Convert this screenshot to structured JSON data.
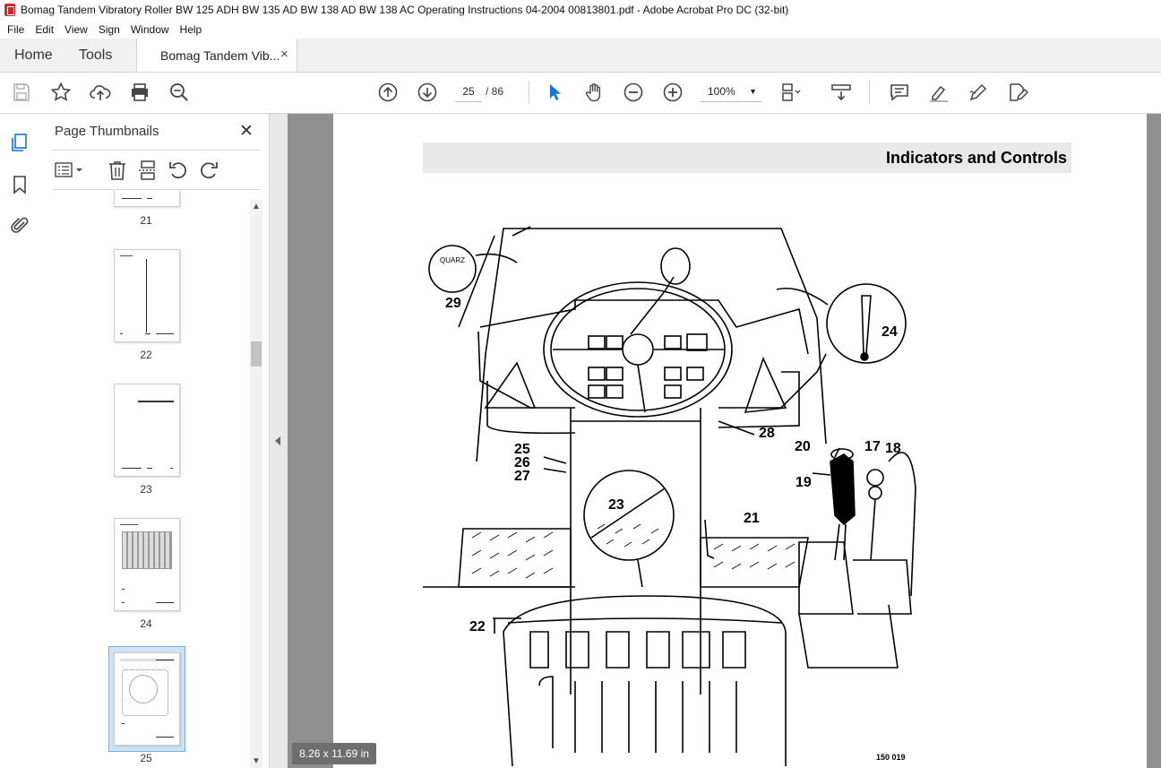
{
  "window": {
    "title": "Bomag Tandem Vibratory Roller BW 125 ADH BW 135 AD BW 138 AD BW 138 AC Operating Instructions 04-2004 00813801.pdf - Adobe Acrobat Pro DC (32-bit)"
  },
  "menu": [
    "File",
    "Edit",
    "View",
    "Sign",
    "Window",
    "Help"
  ],
  "tabs": {
    "home": "Home",
    "tools": "Tools",
    "document": "Bomag Tandem Vib...",
    "close_glyph": "×"
  },
  "toolbar": {
    "current_page": "25",
    "page_total": "/ 86",
    "zoom": "100%",
    "zoom_caret": "▼",
    "icons": [
      "save-icon",
      "bookmark-star-icon",
      "upload-icon",
      "print-icon",
      "search-zoom-icon",
      "page-up-icon",
      "page-down-icon",
      "select-arrow-icon",
      "hand-icon",
      "zoom-out-icon",
      "zoom-in-icon",
      "page-layout-icon",
      "scroll-mode-icon",
      "comment-icon",
      "highlight-icon",
      "draw-icon",
      "fill-sign-icon"
    ]
  },
  "rail": {
    "icons": [
      "page-thumbnails-icon",
      "bookmarks-icon",
      "attachments-icon"
    ]
  },
  "thumbnails_panel": {
    "title": "Page Thumbnails",
    "close_glyph": "✕",
    "pages": [
      "21",
      "22",
      "23",
      "24",
      "25"
    ],
    "selected_page": "25"
  },
  "document": {
    "header": "Indicators and Controls",
    "figure_ref": "150 019",
    "page_size": "8.26 x 11.69 in",
    "callouts": [
      "29",
      "24",
      "28",
      "25",
      "26",
      "27",
      "20",
      "17",
      "18",
      "19",
      "23",
      "21",
      "22"
    ],
    "gauge_label": "QUARZ"
  },
  "colors": {
    "accent_red": "#d7252b",
    "selected_thumb": "#cfe3f6"
  }
}
